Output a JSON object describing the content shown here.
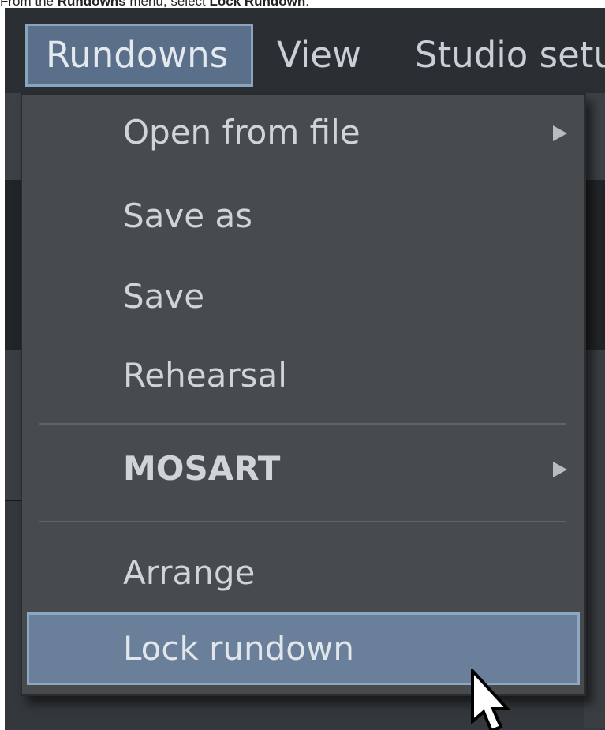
{
  "instruction": {
    "prefix": "From the ",
    "menu_name": "Rundowns",
    "middle": " menu, select ",
    "item_name": "Lock Rundown",
    "suffix": "."
  },
  "menubar": {
    "items": [
      {
        "label": "Rundowns",
        "active": true
      },
      {
        "label": "View",
        "active": false
      },
      {
        "label": "Studio setu",
        "active": false
      }
    ]
  },
  "dropdown": {
    "items": [
      {
        "label": "Open from file",
        "submenu": true
      },
      {
        "label": "Save as",
        "submenu": false
      },
      {
        "label": "Save",
        "submenu": false
      },
      {
        "label": "Rehearsal",
        "submenu": false
      },
      {
        "label": "MOSART",
        "submenu": true,
        "bold": true
      },
      {
        "label": "Arrange",
        "submenu": false
      },
      {
        "label": "Lock rundown",
        "submenu": false,
        "highlighted": true
      }
    ]
  },
  "colors": {
    "menubar_bg": "#2b2f33",
    "dropdown_bg": "#484b4d",
    "highlight_bg": "#6a7f99",
    "highlight_border": "#8ea7c2",
    "text": "#d0d4d8"
  },
  "icons": {
    "submenu_arrow": "triangle-right",
    "cursor": "arrow-pointer"
  }
}
